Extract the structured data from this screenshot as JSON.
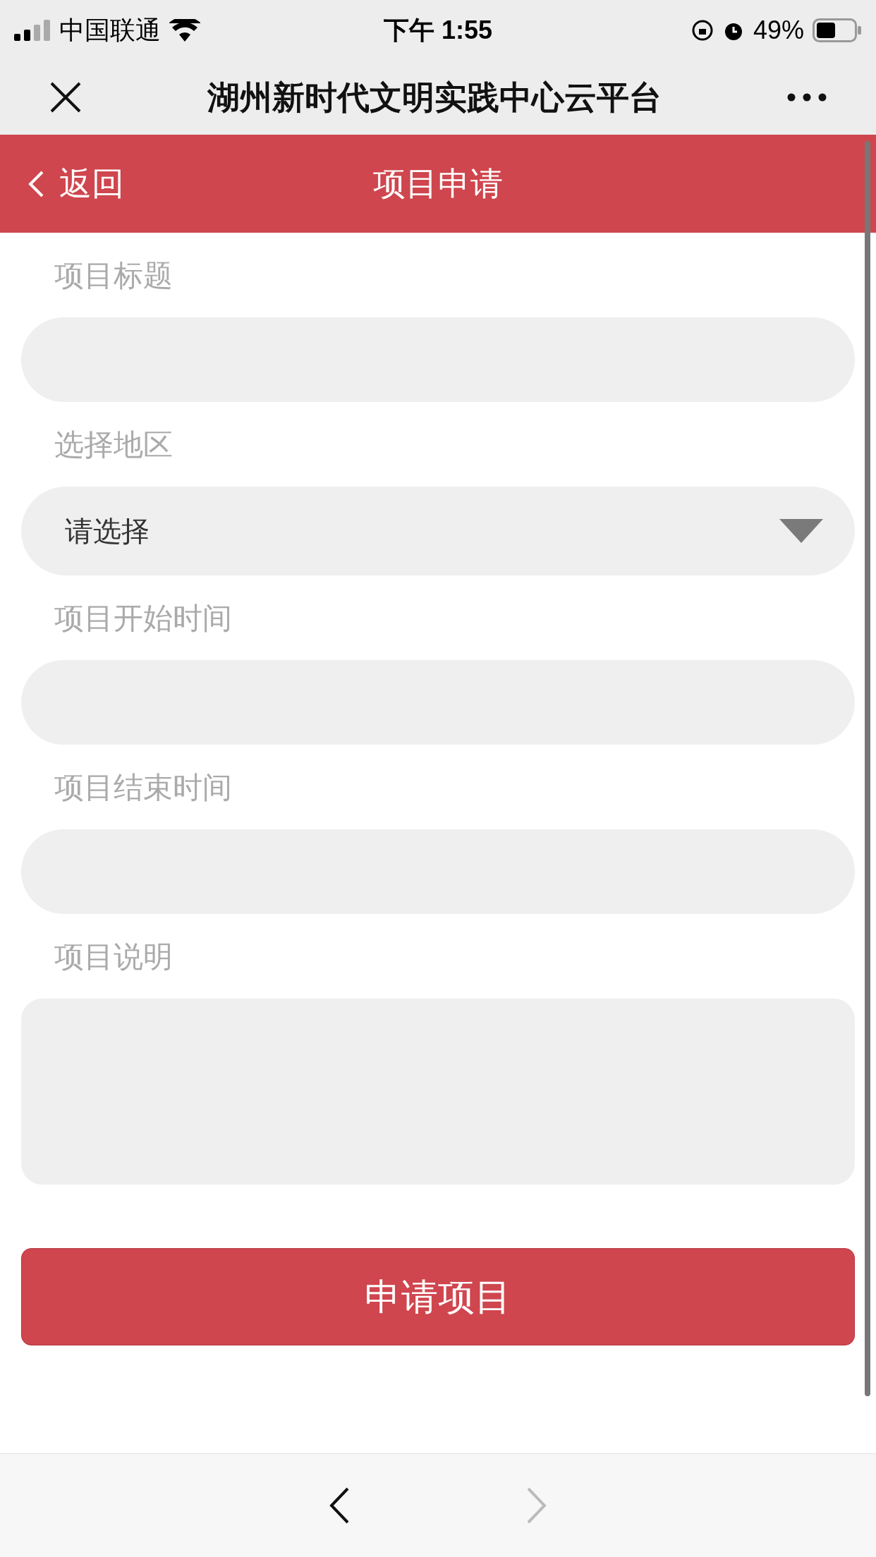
{
  "status_bar": {
    "carrier": "中国联通",
    "time": "下午 1:55",
    "battery": "49%"
  },
  "nav_bar": {
    "title": "湖州新时代文明实践中心云平台"
  },
  "header": {
    "back": "返回",
    "title": "项目申请"
  },
  "fields": [
    {
      "kind": "input",
      "label": "项目标题"
    },
    {
      "kind": "select",
      "label": "选择地区",
      "value": "请选择"
    },
    {
      "kind": "input",
      "label": "项目开始时间"
    },
    {
      "kind": "input",
      "label": "项目结束时间"
    },
    {
      "kind": "textarea",
      "label": "项目说明"
    }
  ],
  "submit": "申请项目",
  "bottom_bar": {
    "back": {
      "disabled": false
    },
    "forward": {
      "disabled": true
    }
  }
}
